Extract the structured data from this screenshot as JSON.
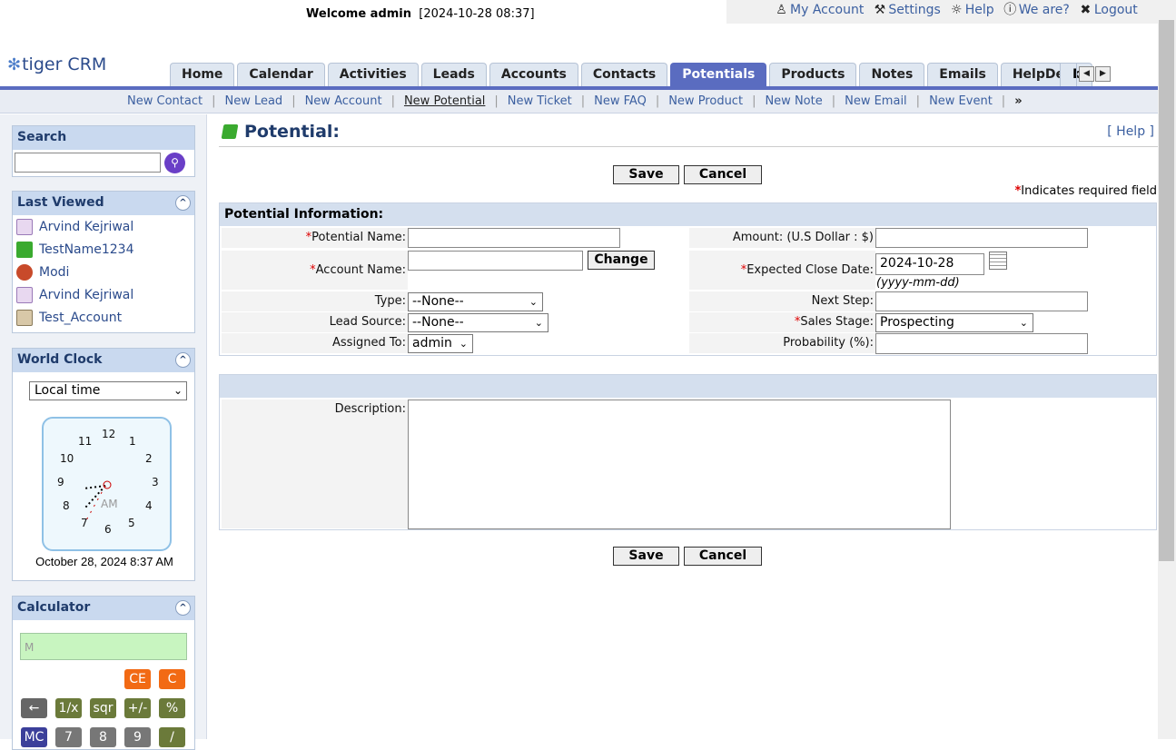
{
  "header": {
    "welcome_user": "Welcome admin",
    "datetime": "[2024-10-28 08:37]",
    "links": [
      {
        "label": "My Account",
        "icon": "person-icon"
      },
      {
        "label": "Settings",
        "icon": "tools-icon"
      },
      {
        "label": "Help",
        "icon": "bulb-icon"
      },
      {
        "label": "We are?",
        "icon": "info-icon"
      },
      {
        "label": "Logout",
        "icon": "close-circle-icon"
      }
    ],
    "logo": "tiger CRM"
  },
  "tabs": [
    "Home",
    "Calendar",
    "Activities",
    "Leads",
    "Accounts",
    "Contacts",
    "Potentials",
    "Products",
    "Notes",
    "Emails",
    "HelpDesk"
  ],
  "active_tab": "Potentials",
  "clipped_tab": "D",
  "quick_links": [
    "New Contact",
    "New Lead",
    "New Account",
    "New Potential",
    "New Ticket",
    "New FAQ",
    "New Product",
    "New Note",
    "New Email",
    "New Event"
  ],
  "quick_more": "»",
  "sidebar": {
    "search_title": "Search",
    "last_viewed_title": "Last Viewed",
    "last_viewed": [
      {
        "label": "Arvind Kejriwal",
        "icon": "contact-card-icon"
      },
      {
        "label": "TestName1234",
        "icon": "potential-icon"
      },
      {
        "label": "Modi",
        "icon": "lead-icon"
      },
      {
        "label": "Arvind Kejriwal",
        "icon": "contact-card-icon"
      },
      {
        "label": "Test_Account",
        "icon": "account-icon"
      }
    ],
    "world_clock_title": "World Clock",
    "world_clock_select": "Local time",
    "clock_ampm": "AM",
    "clock_numbers": [
      "12",
      "1",
      "2",
      "3",
      "4",
      "5",
      "6",
      "7",
      "8",
      "9",
      "10",
      "11"
    ],
    "clock_date": "October 28, 2024 8:37 AM",
    "calculator_title": "Calculator",
    "calc_display": "M",
    "calc_buttons": {
      "ce": "CE",
      "c": "C",
      "back": "←",
      "inv": "1/x",
      "sqr": "sqr",
      "neg": "+/-",
      "pct": "%",
      "mc": "MC",
      "seven": "7",
      "eight": "8",
      "nine": "9",
      "div": "/"
    }
  },
  "form": {
    "title": "Potential:",
    "help": "[ Help ]",
    "save": "Save",
    "cancel": "Cancel",
    "required_note": "Indicates required field",
    "section_title": "Potential Information:",
    "labels": {
      "potential_name": "Potential Name:",
      "account_name": "Account Name:",
      "type": "Type:",
      "lead_source": "Lead Source:",
      "assigned_to": "Assigned To:",
      "amount": "Amount: (U.S Dollar : $)",
      "expected_close_date": "Expected Close Date:",
      "next_step": "Next Step:",
      "sales_stage": "Sales Stage:",
      "probability": "Probability (%):",
      "description": "Description:"
    },
    "change_button": "Change",
    "type_value": "--None--",
    "lead_source_value": "--None--",
    "assigned_to_value": "admin",
    "close_date_value": "2024-10-28",
    "date_format": "(yyyy-mm-dd)",
    "sales_stage_value": "Prospecting"
  }
}
